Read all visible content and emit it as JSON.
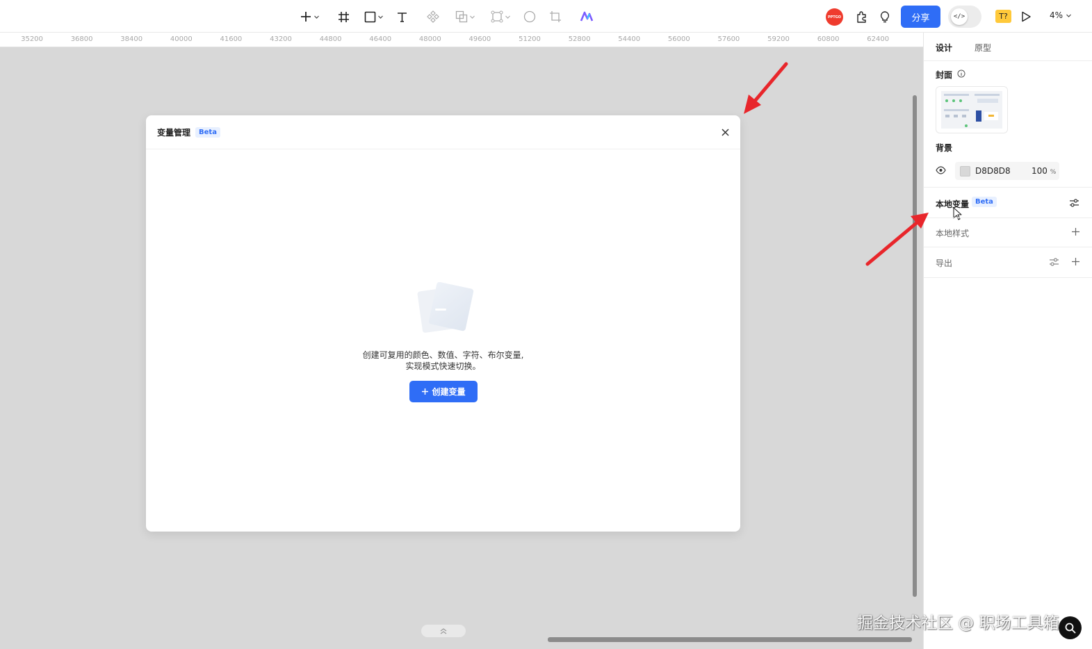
{
  "toolbar": {
    "share_label": "分享",
    "avatar_text": "PPTGO",
    "code_toggle_label": "</>",
    "font_badge": "T?",
    "zoom": "4%",
    "icons": [
      "plus-icon",
      "frame-icon",
      "rectangle-icon",
      "text-icon",
      "component-icon",
      "boolean-icon",
      "vector-edit-icon",
      "circle-icon",
      "crop-icon",
      "ai-logo-icon",
      "plugin-icon",
      "bulb-icon",
      "play-icon"
    ]
  },
  "ruler": {
    "ticks": [
      "35200",
      "36800",
      "38400",
      "40000",
      "41600",
      "43200",
      "44800",
      "46400",
      "48000",
      "49600",
      "51200",
      "52800",
      "54400",
      "56000",
      "57600",
      "59200",
      "60800",
      "62400"
    ]
  },
  "modal": {
    "title": "变量管理",
    "badge": "Beta",
    "empty_line1": "创建可复用的颜色、数值、字符、布尔变量,",
    "empty_line2": "实现模式快速切换。",
    "create_button": "创建变量"
  },
  "panel": {
    "tabs": [
      "设计",
      "原型"
    ],
    "active_tab": "设计",
    "cover_label": "封面",
    "background_label": "背景",
    "background_hex": "D8D8D8",
    "background_opacity": "100",
    "opacity_unit": "%",
    "local_variables_label": "本地变量",
    "local_variables_badge": "Beta",
    "local_styles_label": "本地样式",
    "export_label": "导出"
  },
  "watermark": "掘金技术社区 @ 职场工具箱",
  "colors": {
    "accent": "#2f6df6",
    "canvas": "#d8d8d8",
    "annotation_arrow": "#e8262b"
  }
}
